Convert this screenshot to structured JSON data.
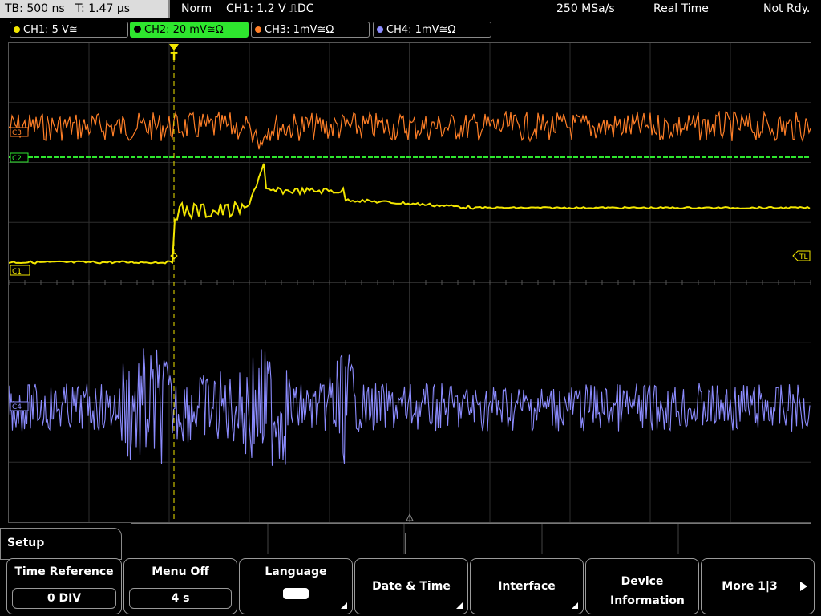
{
  "status_bar": {
    "timebase": "TB: 500 ns",
    "trigger_time": "T: 1.47 µs",
    "mode": "Norm",
    "trigger_info": "CH1: 1.2 V",
    "coupling": "DC",
    "sample_rate": "250 MSa/s",
    "acq_mode": "Real Time",
    "status": "Not Rdy."
  },
  "channels": [
    {
      "label": "CH1: 5 V≅",
      "color": "#f2e600",
      "active": false
    },
    {
      "label": "CH2: 20 mV≅Ω",
      "color": "#2ee62e",
      "active": true
    },
    {
      "label": "CH3: 1mV≅Ω",
      "color": "#ff7f27",
      "active": false
    },
    {
      "label": "CH4: 1mV≅Ω",
      "color": "#8c8cff",
      "active": false
    }
  ],
  "markers": {
    "ch1": "C1",
    "ch2": "C2",
    "ch3": "C3",
    "ch4": "C4",
    "trigger_level": "TL",
    "trigger_pos": "T"
  },
  "menu": {
    "title": "Setup",
    "keys": [
      {
        "label": "Time Reference",
        "value": "0 DIV"
      },
      {
        "label": "Menu Off",
        "value": "4 s"
      },
      {
        "label": "Language"
      },
      {
        "label": "Date & Time"
      },
      {
        "label": "Interface"
      },
      {
        "label": "Device Information"
      },
      {
        "label": "More 1|3"
      }
    ]
  }
}
